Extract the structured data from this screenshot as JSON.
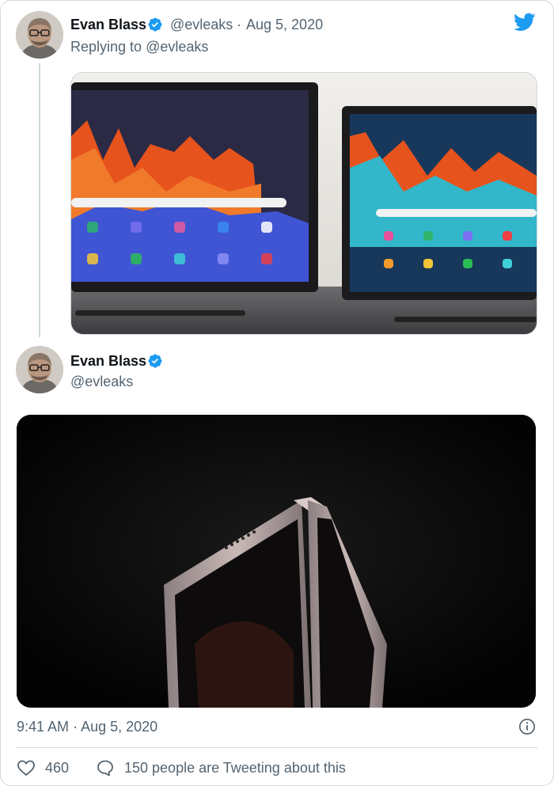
{
  "tweet_parent": {
    "author_name": "Evan Blass",
    "handle": "@evleaks",
    "separator": "·",
    "date": "Aug 5, 2020",
    "replying_prefix": "Replying to",
    "replying_handle": "@evleaks",
    "verified": true
  },
  "tweet_main": {
    "author_name": "Evan Blass",
    "handle": "@evleaks",
    "verified": true,
    "time": "9:41 AM",
    "separator": "·",
    "date": "Aug 5, 2020"
  },
  "actions": {
    "likes": "460",
    "conversation": "150 people are Tweeting about this"
  },
  "icons": {
    "logo": "twitter-bird-icon",
    "verified": "verified-badge-icon",
    "info": "info-icon",
    "like": "heart-icon",
    "comment": "speech-bubble-icon"
  },
  "colors": {
    "brand": "#1d9bf0",
    "text": "#0f1419",
    "secondary": "#536471",
    "border": "#cfd9de"
  }
}
